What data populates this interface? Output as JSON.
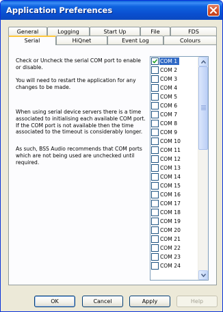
{
  "window": {
    "title": "Application Preferences"
  },
  "tabs": {
    "back_row": [
      {
        "label": "General"
      },
      {
        "label": "Logging"
      },
      {
        "label": "Start Up"
      },
      {
        "label": "File"
      },
      {
        "label": "FDS"
      }
    ],
    "front_row": [
      {
        "label": "Serial",
        "active": true
      },
      {
        "label": "HiQnet"
      },
      {
        "label": "Event Log"
      },
      {
        "label": "Colours"
      }
    ]
  },
  "serial": {
    "paragraphs": [
      "Check or Uncheck the serial COM port to enable or disable.",
      "You will need to restart the application for any changes to be made.",
      "When using serial device servers there is a time associated to initialising each available COM port. If the COM port is not available then the time associated to the timeout is considerably longer.",
      "As such, BSS Audio recommends that COM ports which are not being used are unchecked until required."
    ],
    "ports": [
      {
        "label": "COM 1",
        "checked": true,
        "selected": true
      },
      {
        "label": "COM 2",
        "checked": false
      },
      {
        "label": "COM 3",
        "checked": false
      },
      {
        "label": "COM 4",
        "checked": false
      },
      {
        "label": "COM 5",
        "checked": false
      },
      {
        "label": "COM 6",
        "checked": false
      },
      {
        "label": "COM 7",
        "checked": false
      },
      {
        "label": "COM 8",
        "checked": false
      },
      {
        "label": "COM 9",
        "checked": false
      },
      {
        "label": "COM 10",
        "checked": false
      },
      {
        "label": "COM 11",
        "checked": false
      },
      {
        "label": "COM 12",
        "checked": false
      },
      {
        "label": "COM 13",
        "checked": false
      },
      {
        "label": "COM 14",
        "checked": false
      },
      {
        "label": "COM 15",
        "checked": false
      },
      {
        "label": "COM 16",
        "checked": false
      },
      {
        "label": "COM 17",
        "checked": false
      },
      {
        "label": "COM 18",
        "checked": false
      },
      {
        "label": "COM 19",
        "checked": false
      },
      {
        "label": "COM 20",
        "checked": false
      },
      {
        "label": "COM 21",
        "checked": false
      },
      {
        "label": "COM 22",
        "checked": false
      },
      {
        "label": "COM 23",
        "checked": false
      },
      {
        "label": "COM 24",
        "checked": false
      }
    ]
  },
  "buttons": {
    "ok": "OK",
    "cancel": "Cancel",
    "apply": "Apply",
    "help": "Help"
  },
  "icons": {
    "close": "close-icon",
    "check": "checkmark-icon",
    "scroll_up": "arrow-up-icon",
    "scroll_down": "arrow-down-icon"
  },
  "colors": {
    "title_bar": "#0a4fcf",
    "selection": "#316ac5",
    "active_tab_accent": "#ffc83c",
    "close_button": "#d4502b"
  }
}
